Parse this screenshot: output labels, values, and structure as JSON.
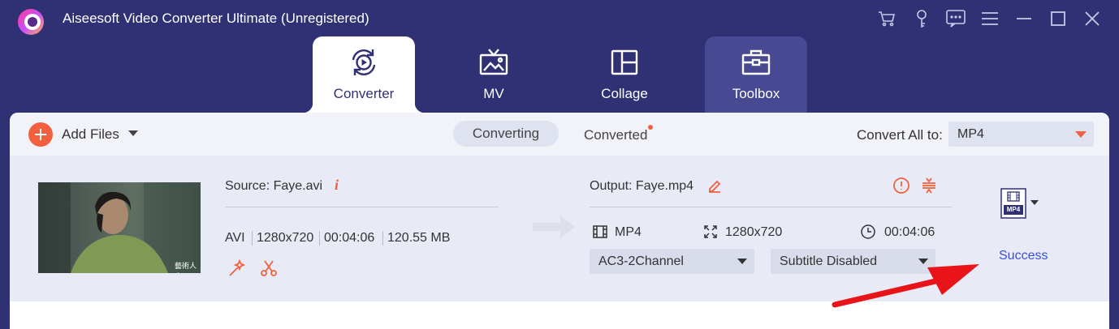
{
  "app": {
    "title": "Aiseesoft Video Converter Ultimate (Unregistered)",
    "icons": [
      "cart-icon",
      "key-icon",
      "feedback-icon",
      "menu-icon",
      "minimize-icon",
      "maximize-icon",
      "close-icon"
    ]
  },
  "nav": {
    "tabs": [
      {
        "label": "Converter",
        "icon": "converter-icon",
        "active": true
      },
      {
        "label": "MV",
        "icon": "tv-icon",
        "active": false
      },
      {
        "label": "Collage",
        "icon": "collage-icon",
        "active": false
      },
      {
        "label": "Toolbox",
        "icon": "toolbox-icon",
        "active": false
      }
    ]
  },
  "toolbar": {
    "add_files": "Add Files",
    "converting": "Converting",
    "converted": "Converted",
    "convert_all_label": "Convert All to:",
    "convert_all_value": "MP4"
  },
  "file": {
    "source": "Source: Faye.avi",
    "format": "AVI",
    "resolution": "1280x720",
    "duration": "00:04:06",
    "size": "120.55 MB",
    "thumbnail_watermark": "藝術人文",
    "output": "Output: Faye.mp4",
    "out_format": "MP4",
    "out_resolution": "1280x720",
    "out_duration": "00:04:06",
    "audio": "AC3-2Channel",
    "subtitle": "Subtitle Disabled",
    "format_badge": "MP4",
    "status": "Success"
  },
  "colors": {
    "background": "#2f3174",
    "accent": "#f2603f",
    "success": "#3d4fd6",
    "annotation_arrow": "#e8141a"
  }
}
